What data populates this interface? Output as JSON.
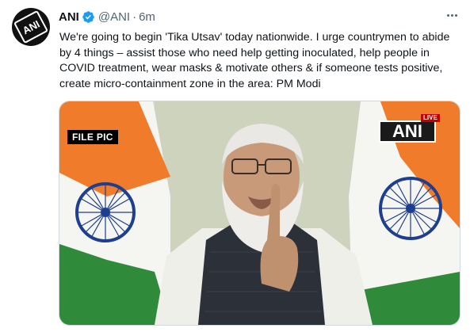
{
  "tweet": {
    "author_name": "ANI",
    "handle": "@ANI",
    "separator": "·",
    "time": "6m",
    "text": "We're going to begin 'Tika Utsav' today nationwide. I urge countrymen to abide by 4 things – assist those who need help getting inoculated, help people in COVID treatment, wear masks & motivate others & if someone tests positive, create micro-containment zone in the area: PM Modi",
    "avatar_logo_text": "ANI",
    "verified_color": "#1d9bf0"
  },
  "media": {
    "file_label": "FILE PIC",
    "watermark": "ANI",
    "live_label": "LIVE"
  },
  "icons": {
    "verified": "verified-badge-icon",
    "more": "more-options-icon"
  }
}
